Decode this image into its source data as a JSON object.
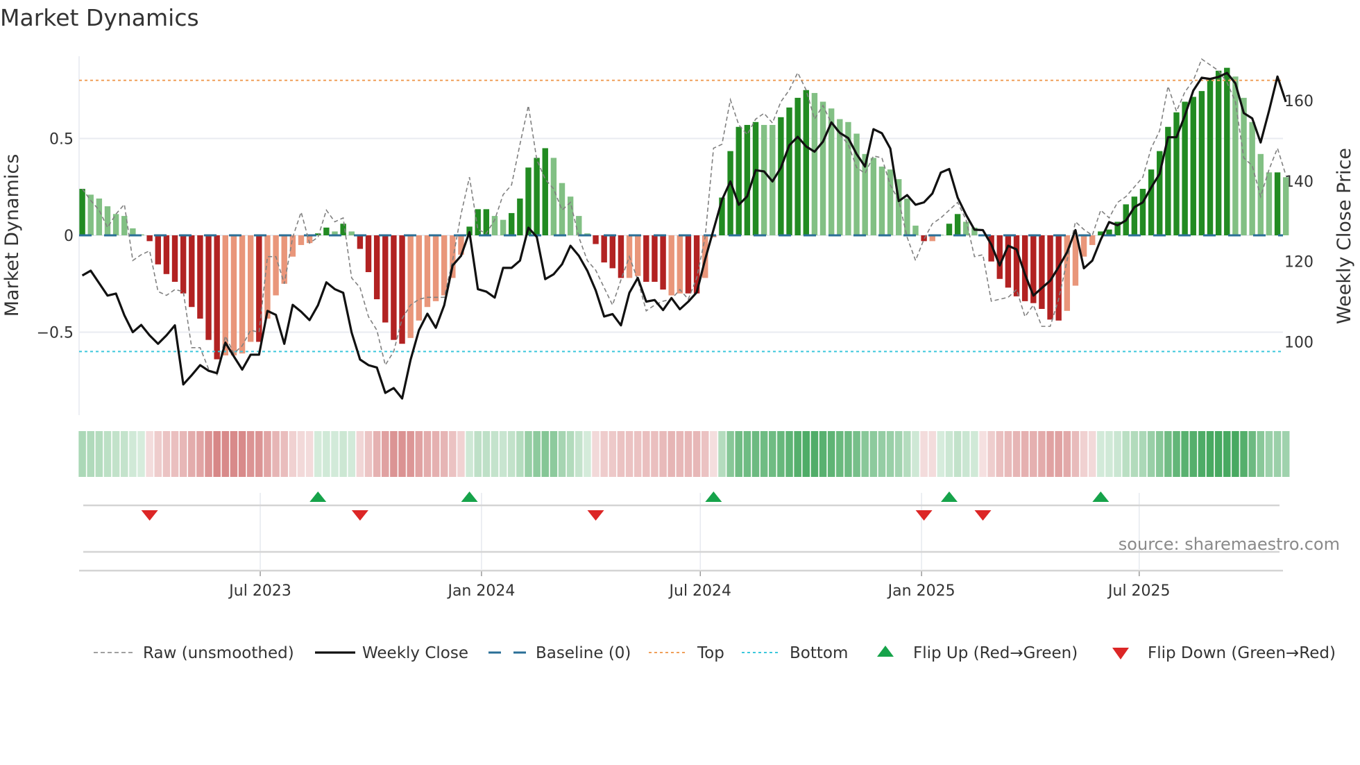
{
  "chart_data": {
    "type": "bar",
    "title": "Market Dynamics",
    "ylabel": "Market Dynamics",
    "y2label": "Weekly Close Price",
    "ylim": [
      -0.93,
      0.93
    ],
    "y2lim": [
      80,
      175
    ],
    "yticks": [
      {
        "v": 0.5,
        "label": "0.5"
      },
      {
        "v": 0,
        "label": "0"
      },
      {
        "v": -0.5,
        "label": "−0.5"
      }
    ],
    "y2ticks": [
      {
        "v": 160,
        "label": "160"
      },
      {
        "v": 140,
        "label": "140"
      },
      {
        "v": 120,
        "label": "120"
      },
      {
        "v": 100,
        "label": "100"
      }
    ],
    "xticks": [
      {
        "date": "2023-07-01",
        "label": "Jul 2023"
      },
      {
        "date": "2024-01-01",
        "label": "Jan 2024"
      },
      {
        "date": "2024-07-01",
        "label": "Jul 2024"
      },
      {
        "date": "2025-01-01",
        "label": "Jan 2025"
      },
      {
        "date": "2025-07-01",
        "label": "Jul 2025"
      }
    ],
    "start_week": "2023-02-03",
    "levels": {
      "top": 0.8,
      "bottom": -0.6,
      "baseline": 0
    },
    "smoothed": [
      0.24,
      0.21,
      0.19,
      0.15,
      0.11,
      0.1,
      0.036,
      0.005,
      -0.03,
      -0.15,
      -0.2,
      -0.24,
      -0.3,
      -0.37,
      -0.43,
      -0.54,
      -0.64,
      -0.62,
      -0.62,
      -0.61,
      -0.55,
      -0.55,
      -0.43,
      -0.31,
      -0.25,
      -0.11,
      -0.05,
      -0.04,
      0.01,
      0.04,
      0.02,
      0.06,
      0.02,
      -0.07,
      -0.19,
      -0.33,
      -0.45,
      -0.54,
      -0.56,
      -0.53,
      -0.44,
      -0.37,
      -0.34,
      -0.31,
      -0.22,
      -0.1,
      0.045,
      0.135,
      0.135,
      0.1,
      0.08,
      0.115,
      0.19,
      0.35,
      0.4,
      0.45,
      0.4,
      0.27,
      0.2,
      0.1,
      0.01,
      -0.045,
      -0.14,
      -0.17,
      -0.22,
      -0.22,
      -0.21,
      -0.24,
      -0.24,
      -0.28,
      -0.31,
      -0.3,
      -0.3,
      -0.3,
      -0.22,
      -0.01,
      0.195,
      0.435,
      0.56,
      0.57,
      0.585,
      0.57,
      0.57,
      0.61,
      0.66,
      0.71,
      0.75,
      0.735,
      0.69,
      0.655,
      0.6,
      0.585,
      0.525,
      0.42,
      0.4,
      0.355,
      0.34,
      0.29,
      0.19,
      0.05,
      -0.03,
      -0.03,
      0.003,
      0.06,
      0.11,
      0.07,
      0.04,
      -0.005,
      -0.135,
      -0.225,
      -0.27,
      -0.315,
      -0.34,
      -0.35,
      -0.38,
      -0.435,
      -0.44,
      -0.39,
      -0.26,
      -0.11,
      -0.05,
      0.02,
      0.03,
      0.07,
      0.16,
      0.2,
      0.24,
      0.34,
      0.435,
      0.56,
      0.635,
      0.69,
      0.715,
      0.745,
      0.81,
      0.85,
      0.865,
      0.82,
      0.71,
      0.585,
      0.42,
      0.325,
      0.325,
      0.3
    ],
    "strong": [
      1,
      0,
      0,
      0,
      0,
      0,
      0,
      0,
      1,
      1,
      1,
      1,
      1,
      1,
      1,
      1,
      1,
      0,
      0,
      0,
      0,
      1,
      0,
      0,
      0,
      0,
      0,
      0,
      1,
      1,
      0,
      1,
      0,
      1,
      1,
      1,
      1,
      1,
      1,
      0,
      0,
      0,
      0,
      0,
      0,
      0,
      1,
      1,
      1,
      0,
      0,
      1,
      1,
      1,
      1,
      1,
      0,
      0,
      0,
      0,
      0,
      1,
      1,
      1,
      1,
      0,
      0,
      1,
      1,
      1,
      0,
      0,
      1,
      1,
      0,
      0,
      1,
      1,
      1,
      1,
      1,
      0,
      0,
      1,
      1,
      1,
      1,
      0,
      0,
      0,
      0,
      0,
      0,
      0,
      0,
      0,
      0,
      0,
      0,
      0,
      1,
      0,
      0,
      1,
      1,
      0,
      0,
      0,
      1,
      1,
      1,
      1,
      1,
      1,
      1,
      1,
      1,
      0,
      0,
      0,
      0,
      1,
      1,
      1,
      1,
      1,
      1,
      1,
      1,
      1,
      1,
      1,
      1,
      1,
      1,
      1,
      1,
      0,
      0,
      0,
      0,
      0,
      1,
      0
    ],
    "raw": [
      0.24,
      0.18,
      0.13,
      0.04,
      0.11,
      0.16,
      -0.13,
      -0.1,
      -0.08,
      -0.29,
      -0.31,
      -0.28,
      -0.29,
      -0.58,
      -0.58,
      -0.69,
      -0.72,
      -0.52,
      -0.61,
      -0.57,
      -0.49,
      -0.5,
      -0.11,
      -0.11,
      -0.25,
      -0.01,
      0.12,
      -0.04,
      -0.01,
      0.13,
      0.07,
      0.09,
      -0.22,
      -0.27,
      -0.42,
      -0.49,
      -0.67,
      -0.6,
      -0.43,
      -0.36,
      -0.33,
      -0.32,
      -0.32,
      -0.32,
      -0.13,
      0.11,
      0.3,
      0.03,
      0.01,
      0.08,
      0.21,
      0.26,
      0.47,
      0.67,
      0.39,
      0.29,
      0.24,
      0.13,
      0.17,
      -0.01,
      -0.13,
      -0.18,
      -0.27,
      -0.36,
      -0.23,
      -0.11,
      -0.23,
      -0.39,
      -0.36,
      -0.34,
      -0.33,
      -0.28,
      -0.33,
      -0.22,
      -0.01,
      0.45,
      0.47,
      0.7,
      0.57,
      0.52,
      0.6,
      0.63,
      0.58,
      0.69,
      0.75,
      0.84,
      0.75,
      0.6,
      0.67,
      0.58,
      0.52,
      0.47,
      0.35,
      0.32,
      0.41,
      0.4,
      0.26,
      0.18,
      -0.01,
      -0.13,
      -0.02,
      0.06,
      0.09,
      0.13,
      0.17,
      0.08,
      -0.11,
      -0.1,
      -0.34,
      -0.33,
      -0.32,
      -0.28,
      -0.42,
      -0.36,
      -0.47,
      -0.47,
      -0.33,
      -0.13,
      0.07,
      0.03,
      0.0,
      0.13,
      0.09,
      0.17,
      0.2,
      0.25,
      0.3,
      0.45,
      0.54,
      0.77,
      0.64,
      0.74,
      0.8,
      0.91,
      0.88,
      0.85,
      0.79,
      0.69,
      0.4,
      0.36,
      0.2,
      0.34,
      0.45,
      0.31
    ],
    "close": [
      116.5,
      117.7,
      114.6,
      111.5,
      112,
      106.6,
      102.4,
      104.2,
      101.6,
      99.5,
      101.6,
      104.1,
      89.4,
      91.7,
      94.2,
      92.8,
      92.2,
      99.8,
      96.4,
      93.1,
      96.8,
      96.8,
      107.7,
      106.7,
      99.5,
      109.2,
      107.5,
      105.4,
      109.1,
      114.8,
      113.1,
      112.2,
      102.3,
      95.6,
      94.2,
      93.6,
      87.3,
      88.5,
      85.9,
      95.5,
      102.9,
      107,
      103.5,
      109.1,
      119,
      121.4,
      127.3,
      113.1,
      112.5,
      111,
      118.4,
      118.4,
      120.2,
      128.4,
      126.1,
      115.6,
      116.8,
      119.3,
      123.9,
      121.4,
      117.7,
      112.8,
      106.3,
      106.9,
      104.1,
      112.2,
      115.9,
      110,
      110.4,
      107.9,
      110.9,
      108.1,
      110,
      112.3,
      120.5,
      127.9,
      135.3,
      139.9,
      134.1,
      136.2,
      142.7,
      142.4,
      139.9,
      143.3,
      148.9,
      151,
      148.6,
      147.3,
      149.8,
      154.6,
      152,
      150.7,
      146.7,
      143.6,
      152.9,
      151.9,
      148.1,
      135,
      136.5,
      134.1,
      134.7,
      136.9,
      142.1,
      143,
      135.9,
      131.6,
      127.9,
      127.8,
      124.2,
      119,
      123.9,
      123,
      116.8,
      111.5,
      113.4,
      115.2,
      118.6,
      122.3,
      127.8,
      118.3,
      120.2,
      125.4,
      129.8,
      129,
      130.2,
      133.5,
      134.7,
      138.4,
      141.8,
      150.9,
      150.9,
      156.3,
      162.5,
      165.7,
      165.4,
      165.9,
      166.9,
      164.3,
      156.9,
      155.6,
      149.6,
      157.5,
      166,
      159.7
    ],
    "flip_up_weeks": [
      29,
      47,
      76,
      104,
      122
    ],
    "flip_down_weeks": [
      9,
      34,
      62,
      101,
      108
    ],
    "legend": {
      "position": "bottom",
      "items": [
        {
          "key": "raw",
          "label": "Raw (unsmoothed)"
        },
        {
          "key": "close",
          "label": "Weekly Close"
        },
        {
          "key": "baseline",
          "label": "Baseline (0)"
        },
        {
          "key": "top",
          "label": "Top"
        },
        {
          "key": "bottom",
          "label": "Bottom"
        },
        {
          "key": "flip_up",
          "label": "Flip Up (Red→Green)"
        },
        {
          "key": "flip_down",
          "label": "Flip Down (Green→Red)"
        }
      ]
    },
    "annotation": "source: sharemaestro.com",
    "colors": {
      "green_strong": "#228b22",
      "green_weak": "#82c084",
      "red_strong": "#b22222",
      "red_weak": "#e9967a",
      "raw": "#808080",
      "close": "#111111",
      "baseline": "#2a6f97",
      "top": "#f0a05a",
      "bottom": "#3cc8dc",
      "flip_up": "#16a34a",
      "flip_down": "#dc2626"
    }
  }
}
